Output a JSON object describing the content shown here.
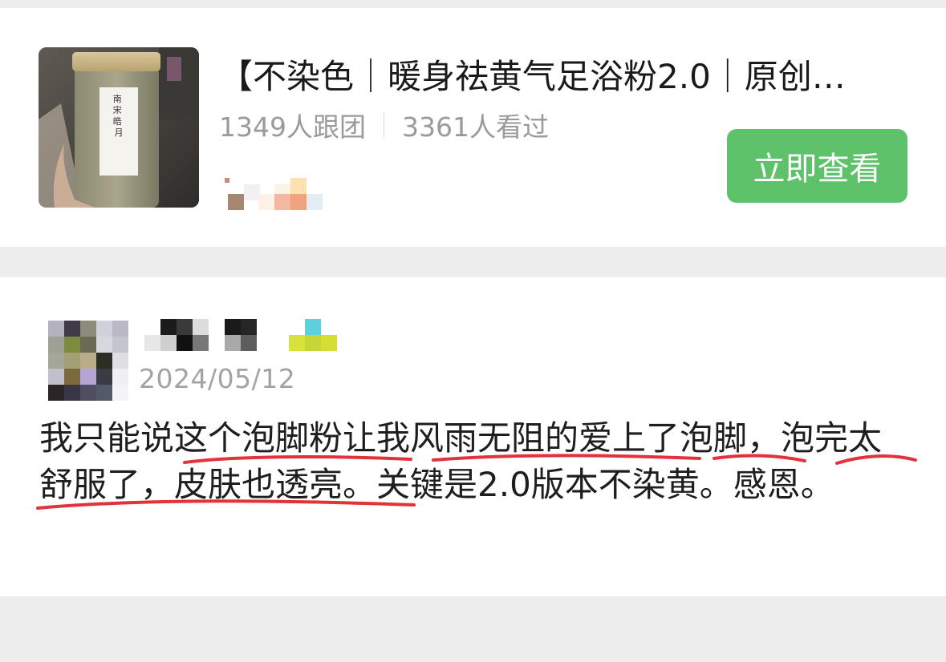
{
  "product": {
    "title": "【不染色｜暖身祛黄气足浴粉2.0｜原创…",
    "jar_label_text": "南宋皓月",
    "followers": "1349人跟团",
    "views": "3361人看过",
    "view_button": "立即查看"
  },
  "review": {
    "date": "2024/05/12",
    "text": "我只能说这个泡脚粉让我风雨无阻的爱上了泡脚，泡完太舒服了，皮肤也透亮。关键是2.0版本不染黄。感恩。"
  },
  "colors": {
    "accent_green": "#5ec26a",
    "underline_red": "#e2333a",
    "muted_gray": "#9a9a9a"
  },
  "icons": {
    "separator": "vertical-divider"
  }
}
